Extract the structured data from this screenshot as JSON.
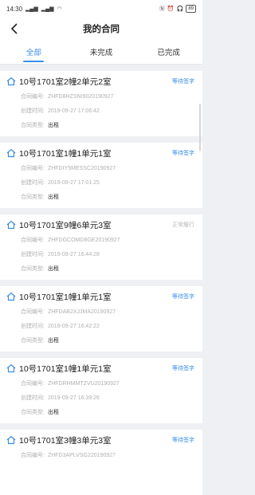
{
  "status_bar": {
    "time": "14:30",
    "battery": "89"
  },
  "header": {
    "title": "我的合同"
  },
  "tabs": [
    {
      "label": "全部",
      "active": true
    },
    {
      "label": "未完成",
      "active": false
    },
    {
      "label": "已完成",
      "active": false
    }
  ],
  "labels": {
    "contract_no": "合同编号:",
    "created": "创建时间:",
    "type": "合同类型:"
  },
  "contracts": [
    {
      "title": "10号1701室2幢2单元2室",
      "status": "等待签字",
      "status_color": "#3a8ee6",
      "number": "ZHFD8HZSNI9020190927",
      "created": "2019-09-27 17:06:42",
      "type": "出租"
    },
    {
      "title": "10号1701室1幢1单元1室",
      "status": "等待签字",
      "status_color": "#3a8ee6",
      "number": "ZHFDIY5MESSC20190927",
      "created": "2019-09-27 17:01:25",
      "type": "出租"
    },
    {
      "title": "10号1701室9幢6单元3室",
      "status": "正常履行",
      "status_color": "#b8b8b8",
      "number": "ZHFDGCOMD8GE20190927",
      "created": "2019-09-27 16:44:28",
      "type": "出租"
    },
    {
      "title": "10号1701室1幢1单元1室",
      "status": "等待签字",
      "status_color": "#3a8ee6",
      "number": "ZHFDAB2XJJMA20190927",
      "created": "2019-09-27 16:42:22",
      "type": "出租"
    },
    {
      "title": "10号1701室1幢1单元1室",
      "status": "等待签字",
      "status_color": "#3a8ee6",
      "number": "ZHFDRHMMTZVU20190927",
      "created": "2019-09-27 16:39:26",
      "type": "出租"
    },
    {
      "title": "10号1701室3幢3单元3室",
      "status": "等待签字",
      "status_color": "#3a8ee6",
      "number": "ZHFD3APLVSG220190927",
      "created": "",
      "type": ""
    }
  ]
}
